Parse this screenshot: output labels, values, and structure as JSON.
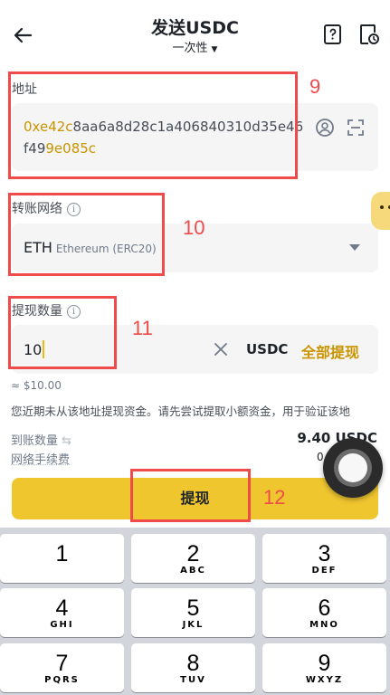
{
  "header": {
    "title": "发送USDC",
    "subtitle": "一次性"
  },
  "address": {
    "label": "地址",
    "value_head": "0xe42c",
    "value_mid": "8aa6a8d28c1a406840310d35e46f49",
    "value_tail": "9e085c"
  },
  "network": {
    "label": "转账网络",
    "symbol": "ETH",
    "name": "Ethereum (ERC20)"
  },
  "amount": {
    "label": "提现数量",
    "value": "10",
    "unit": "USDC",
    "max_label": "全部提现",
    "approx": "≈ $10.00",
    "warning": "您近期未从该地址提现资金。请先尝试提取小额资金，用于验证该地"
  },
  "summary": {
    "receive_label": "到账数量",
    "receive_value": "9.40 USDC",
    "fee_label": "网络手续费",
    "fee_value": "0"
  },
  "submit_label": "提现",
  "annotations": {
    "address": "9",
    "network": "10",
    "amount": "11",
    "submit": "12"
  },
  "keypad": [
    {
      "num": "1",
      "letters": ""
    },
    {
      "num": "2",
      "letters": "ABC"
    },
    {
      "num": "3",
      "letters": "DEF"
    },
    {
      "num": "4",
      "letters": "GHI"
    },
    {
      "num": "5",
      "letters": "JKL"
    },
    {
      "num": "6",
      "letters": "MNO"
    },
    {
      "num": "7",
      "letters": "PQRS"
    },
    {
      "num": "8",
      "letters": "TUV"
    },
    {
      "num": "9",
      "letters": "WXYZ"
    }
  ],
  "colors": {
    "accent": "#f0c62f",
    "highlight_text": "#c99400",
    "annotation": "#ef4b4b"
  }
}
